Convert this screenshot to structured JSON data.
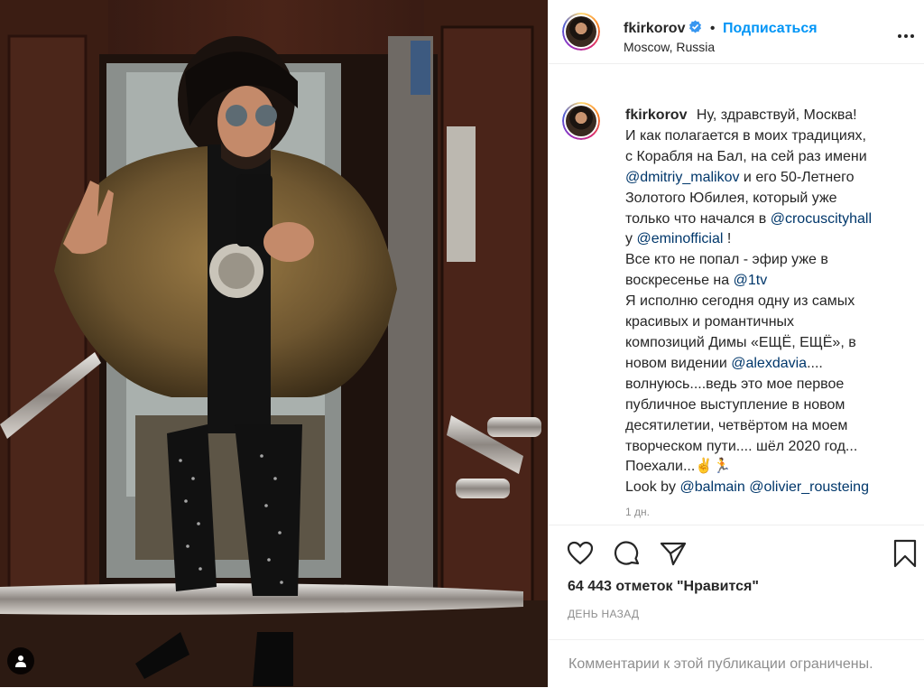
{
  "header": {
    "username": "fkirkorov",
    "follow_label": "Подписаться",
    "location": "Moscow, Russia",
    "verified_icon": "verified-badge-icon",
    "more_icon": "more-options-icon"
  },
  "caption": {
    "username": "fkirkorov",
    "lines": [
      [
        "Ну, здравствуй, Москва!"
      ],
      [
        "И как полагается в моих традициях,"
      ],
      [
        "с Корабля на Бал, на сей раз имени"
      ],
      [
        "@dmitriy_malikov",
        " и его 50-Летнего"
      ],
      [
        "Золотого Юбилея, который уже"
      ],
      [
        "только что начался в ",
        "@crocuscityhall"
      ],
      [
        "у ",
        "@eminofficial",
        " !"
      ],
      [
        "Все кто не попал - эфир уже в"
      ],
      [
        "воскресенье на ",
        "@1tv"
      ],
      [
        "Я исполню сегодня одну из самых"
      ],
      [
        "красивых и романтичных"
      ],
      [
        "композиций Димы «ЕЩЁ, ЕЩЁ», в"
      ],
      [
        "новом видении ",
        "@alexdavia",
        "...."
      ],
      [
        "волнуюсь....ведь это мое первое"
      ],
      [
        "публичное выступление в новом"
      ],
      [
        "десятилетии, четвёртом на моем"
      ],
      [
        "творческом пути.... шёл 2020 год..."
      ],
      [
        "Поехали...✌️🏃"
      ],
      [
        "Look by ",
        "@balmain",
        " ",
        "@olivier_rousteing"
      ]
    ],
    "time": "1 дн."
  },
  "actions": {
    "like_icon": "heart-icon",
    "comment_icon": "comment-icon",
    "share_icon": "share-icon",
    "save_icon": "bookmark-icon",
    "likes_count": "64 443",
    "likes_suffix": " отметок \"Нравится\"",
    "date": "ДЕНЬ НАЗАД",
    "comments_limited": "Комментарии к этой публикации ограничены."
  },
  "photo": {
    "user_tag_icon": "user-tag-icon"
  },
  "colors": {
    "accent": "#0095f6",
    "mention": "#00376b",
    "muted": "#8e8e8e",
    "border": "#efefef"
  }
}
